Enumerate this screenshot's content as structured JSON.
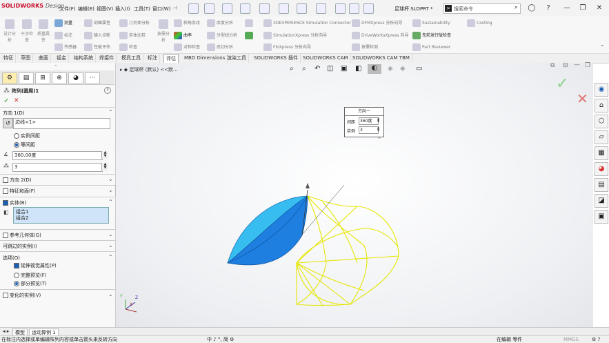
{
  "app": {
    "brand": "SOLIDWORKS",
    "brand_suffix": "Design",
    "doc_title": "足球杯.SLDPRT *"
  },
  "menu": [
    "文件(F)",
    "编辑(E)",
    "视图(V)",
    "插入(I)",
    "工具(T)",
    "窗口(W)"
  ],
  "search": {
    "placeholder": "搜索命令"
  },
  "ribbon": {
    "big": [
      {
        "label": "设计分析",
        "icon": "design-check-icon"
      },
      {
        "label": "干涉检查",
        "icon": "interference-icon"
      },
      {
        "label": "质量属性",
        "icon": "mass-props-icon"
      }
    ],
    "col1": [
      "测量",
      "标注",
      "传感器"
    ],
    "col2": [
      "剖面属性",
      "输入诊断",
      "性能评估"
    ],
    "col3": [
      "几何体分析",
      "实体比较",
      "检查"
    ],
    "col4_big": "按需分析",
    "col5": [
      "斜角条纹",
      "曲率",
      "对称检查"
    ],
    "col6": [
      "厚度分析",
      "分型线分析",
      "底切分析"
    ],
    "col7": [
      "拔模分析"
    ],
    "col8": [
      "3DEXPERIENCE Simulation Connector",
      "SimulationXpress 分析向导",
      "FloXpress 分析向导"
    ],
    "col9": [
      "DFMXpress 分析向导",
      "DriveWorksXpress 向导",
      "按需检测"
    ],
    "col10": [
      "Sustainability",
      "先前发行版检查",
      "Part Reviewer"
    ],
    "col11": [
      "Costing"
    ],
    "active_item": "测量"
  },
  "tabs": [
    "特征",
    "草图",
    "曲面",
    "钣金",
    "结构系统",
    "焊接件",
    "模具工具",
    "标注",
    "评估",
    "MBD Dimensions",
    "渲染工具",
    "SOLIDWORKS 插件",
    "SOLIDWORKS CAM",
    "SOLIDWORKS CAM TBM"
  ],
  "active_tab": "评估",
  "breadcrumb": "足球杯 (默认) <<默...",
  "panel": {
    "title": "阵列(圆周)1",
    "help": "?",
    "ok": "✓",
    "cancel": "✕",
    "dir1": {
      "label": "方向 1(D)",
      "edge": "边线<1>",
      "radio_spacing_between": "实例间距",
      "radio_equal": "等间距",
      "angle": "360.00度",
      "count": "3"
    },
    "dir2": {
      "label": "方向 2(D)"
    },
    "features": {
      "label": "特征和面(F)"
    },
    "bodies": {
      "label": "实体(B)",
      "items": [
        "组合1",
        "组合2"
      ]
    },
    "ref_geometry": {
      "label": "参考几何体(G)"
    },
    "skip_instances": {
      "label": "可跳过的实例(I)"
    },
    "options": {
      "label": "选项(O)",
      "propagate": "延伸视觉属性(P)",
      "full_preview": "完整预览(F)",
      "partial_preview": "部分预览(T)"
    },
    "vary_instances": {
      "label": "变化的实例(V)"
    }
  },
  "popup": {
    "title": "方向一",
    "spacing_label": "间距",
    "spacing_value": "360度",
    "count_label": "实例",
    "count_value": "3"
  },
  "bottom_tabs": [
    "模型",
    "运动算例 1"
  ],
  "active_bottom_tab": "运动算例 1",
  "status": {
    "hint": "在标注内选择或单编辑阵列内容或单击箭头来反转方向",
    "ime": "中 ♪ °, 简 ⚙",
    "mode": "在编辑 零件",
    "units": "MMGS"
  },
  "colors": {
    "accent": "#1a5fb4",
    "part_blue": "#1e7fe0",
    "preview_yellow": "#f2f200",
    "confirm_green": "#8ad18a",
    "cancel_red": "#e07070"
  }
}
